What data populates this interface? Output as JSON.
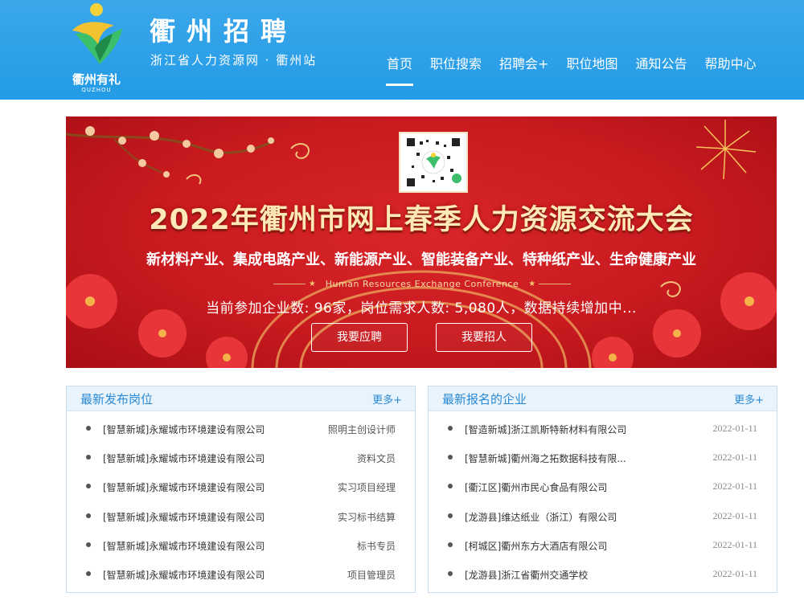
{
  "header": {
    "site_title": "衢州招聘",
    "site_subtitle": "浙江省人力资源网 · 衢州站",
    "logo_text": "衢州有礼",
    "logo_sub": "QUZHOU"
  },
  "nav": {
    "items": [
      "首页",
      "职位搜索",
      "招聘会+",
      "职位地图",
      "通知公告",
      "帮助中心"
    ],
    "active": "首页"
  },
  "banner": {
    "title": "2022年衢州市网上春季人力资源交流大会",
    "industries": "新材料产业、集成电路产业、新能源产业、智能装备产业、特种纸产业、生命健康产业",
    "english": "Human Resources Exchange Conference",
    "stats": "当前参加企业数: 96家，岗位需求人数: 5,080人，数据持续增加中...",
    "btn_apply": "我要应聘",
    "btn_hire": "我要招人"
  },
  "latest_jobs": {
    "title": "最新发布岗位",
    "more": "更多+",
    "items": [
      {
        "company": "[智慧新城]永耀城市环境建设有限公司",
        "position": "照明主创设计师"
      },
      {
        "company": "[智慧新城]永耀城市环境建设有限公司",
        "position": "资料文员"
      },
      {
        "company": "[智慧新城]永耀城市环境建设有限公司",
        "position": "实习项目经理"
      },
      {
        "company": "[智慧新城]永耀城市环境建设有限公司",
        "position": "实习标书结算"
      },
      {
        "company": "[智慧新城]永耀城市环境建设有限公司",
        "position": "标书专员"
      },
      {
        "company": "[智慧新城]永耀城市环境建设有限公司",
        "position": "项目管理员"
      }
    ]
  },
  "latest_companies": {
    "title": "最新报名的企业",
    "more": "更多+",
    "items": [
      {
        "company": "[智造新城]浙江凯斯特新材料有限公司",
        "date": "2022-01-11"
      },
      {
        "company": "[智慧新城]衢州海之拓数据科技有限...",
        "date": "2022-01-11"
      },
      {
        "company": "[衢江区]衢州市民心食品有限公司",
        "date": "2022-01-11"
      },
      {
        "company": "[龙游县]维达纸业（浙江）有限公司",
        "date": "2022-01-11"
      },
      {
        "company": "[柯城区]衢州东方大酒店有限公司",
        "date": "2022-01-11"
      },
      {
        "company": "[龙游县]浙江省衢州交通学校",
        "date": "2022-01-11"
      }
    ]
  },
  "colors": {
    "header_blue": "#239be6",
    "banner_red": "#c81a1f",
    "accent_blue": "#2a8ad6"
  }
}
